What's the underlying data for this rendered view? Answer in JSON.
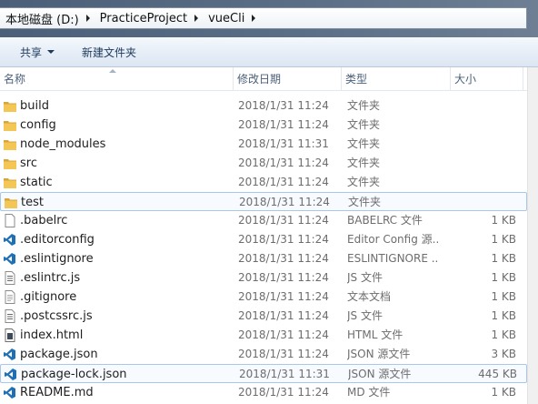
{
  "address_bar": {
    "crumbs": [
      "本地磁盘 (D:)",
      "PracticeProject",
      "vueCli"
    ]
  },
  "toolbar": {
    "share_label": "共享",
    "new_folder_label": "新建文件夹"
  },
  "columns": {
    "name": "名称",
    "date": "修改日期",
    "type": "类型",
    "size": "大小"
  },
  "files": [
    {
      "name": "build",
      "date": "2018/1/31 11:24",
      "type": "文件夹",
      "size": "",
      "icon": "folder-icon"
    },
    {
      "name": "config",
      "date": "2018/1/31 11:24",
      "type": "文件夹",
      "size": "",
      "icon": "folder-icon"
    },
    {
      "name": "node_modules",
      "date": "2018/1/31 11:31",
      "type": "文件夹",
      "size": "",
      "icon": "folder-icon"
    },
    {
      "name": "src",
      "date": "2018/1/31 11:24",
      "type": "文件夹",
      "size": "",
      "icon": "folder-icon"
    },
    {
      "name": "static",
      "date": "2018/1/31 11:24",
      "type": "文件夹",
      "size": "",
      "icon": "folder-icon"
    },
    {
      "name": "test",
      "date": "2018/1/31 11:24",
      "type": "文件夹",
      "size": "",
      "icon": "folder-icon"
    },
    {
      "name": ".babelrc",
      "date": "2018/1/31 11:24",
      "type": "BABELRC 文件",
      "size": "1 KB",
      "icon": "blank-file-icon"
    },
    {
      "name": ".editorconfig",
      "date": "2018/1/31 11:24",
      "type": "Editor Config 源...",
      "size": "1 KB",
      "icon": "vscode-file-icon"
    },
    {
      "name": ".eslintignore",
      "date": "2018/1/31 11:24",
      "type": "ESLINTIGNORE ...",
      "size": "1 KB",
      "icon": "vscode-file-icon"
    },
    {
      "name": ".eslintrc.js",
      "date": "2018/1/31 11:24",
      "type": "JS 文件",
      "size": "1 KB",
      "icon": "js-file-icon"
    },
    {
      "name": ".gitignore",
      "date": "2018/1/31 11:24",
      "type": "文本文档",
      "size": "1 KB",
      "icon": "text-file-icon"
    },
    {
      "name": ".postcssrc.js",
      "date": "2018/1/31 11:24",
      "type": "JS 文件",
      "size": "1 KB",
      "icon": "js-file-icon"
    },
    {
      "name": "index.html",
      "date": "2018/1/31 11:24",
      "type": "HTML 文件",
      "size": "1 KB",
      "icon": "html-file-icon"
    },
    {
      "name": "package.json",
      "date": "2018/1/31 11:24",
      "type": "JSON 源文件",
      "size": "3 KB",
      "icon": "vscode-file-icon"
    },
    {
      "name": "package-lock.json",
      "date": "2018/1/31 11:31",
      "type": "JSON 源文件",
      "size": "445 KB",
      "icon": "vscode-file-icon"
    },
    {
      "name": "README.md",
      "date": "2018/1/31 11:24",
      "type": "MD 文件",
      "size": "1 KB",
      "icon": "vscode-file-icon"
    }
  ],
  "outlined_rows": [
    "test",
    "package-lock.json"
  ],
  "colors": {
    "folder": "#e8b74a",
    "vscode_blue": "#1f6fb5",
    "header_text": "#4c607a",
    "detail_text": "#6d6d6d"
  }
}
